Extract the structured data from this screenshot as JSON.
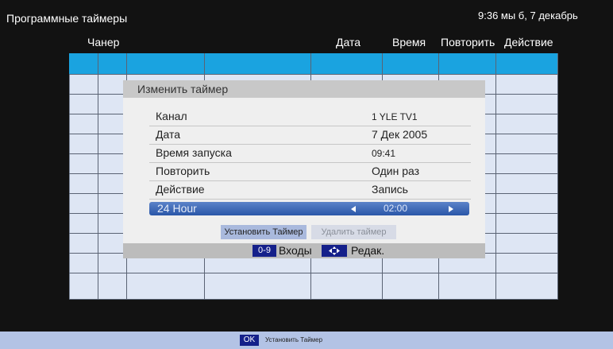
{
  "header": {
    "title": "Программные таймеры",
    "clock": "9:36 мы б, 7 декабрь"
  },
  "table": {
    "columns": [
      "Чанер",
      "Дата",
      "Время",
      "Повторить",
      "Действие"
    ]
  },
  "dialog": {
    "title": "Изменить таймер",
    "fields": [
      {
        "label": "Канал",
        "value": "1 YLE TV1"
      },
      {
        "label": "Дата",
        "value": "7 Дек 2005"
      },
      {
        "label": "Время запуска",
        "value": "09:41"
      },
      {
        "label": "Повторить",
        "value": "Один раз"
      },
      {
        "label": "Действие",
        "value": "Запись"
      }
    ],
    "selected_field": {
      "label": "24 Hour",
      "value": "02:00"
    },
    "buttons": {
      "set_timer": "Установить Таймер",
      "delete_timer": "Удалить таймер"
    },
    "footer": {
      "key_digits": "0-9",
      "inputs_label": "Входы",
      "edit_label": "Редак."
    }
  },
  "bottom_bar": {
    "ok_key": "OK",
    "hint": "Установить Таймер"
  },
  "colors": {
    "accent": "#1aa3e0",
    "key_badge": "#15208a",
    "selected_row": "#2a56a8"
  }
}
